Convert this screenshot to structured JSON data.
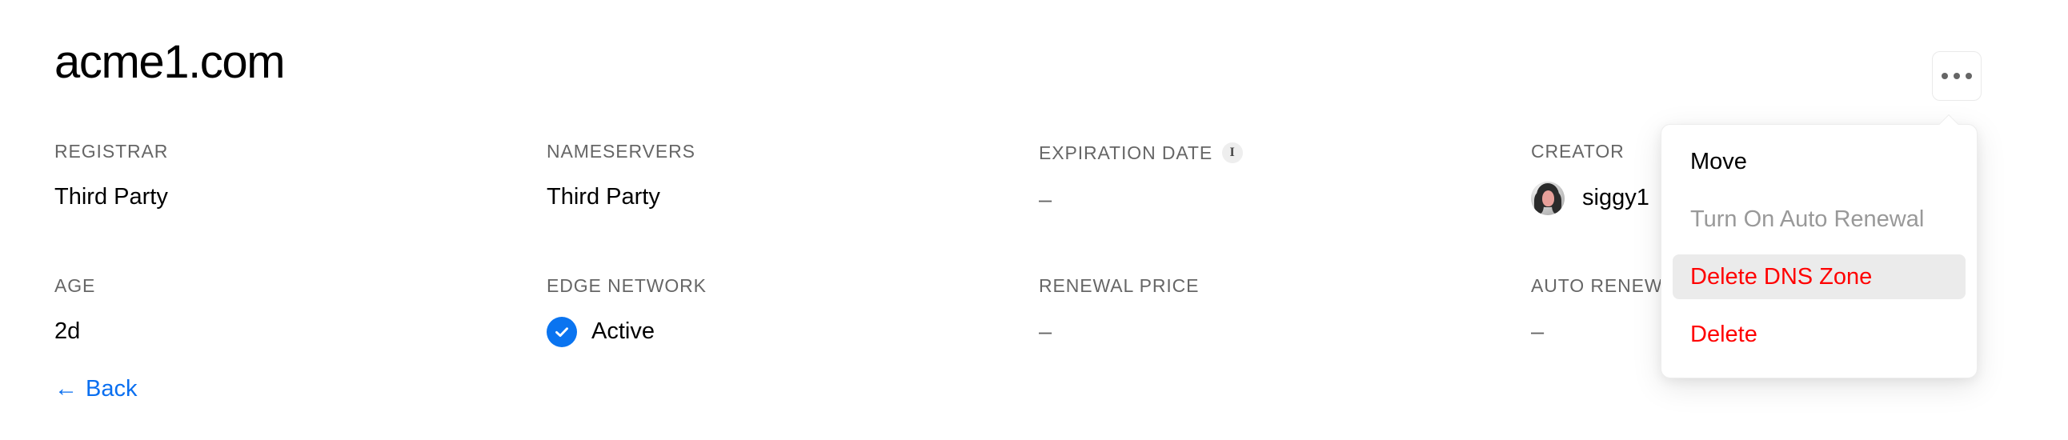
{
  "header": {
    "title": "acme1.com",
    "overflow_button_label": "…",
    "overflow_icon": "ellipsis-icon"
  },
  "fields": [
    {
      "label": "REGISTRAR",
      "value": "Third Party",
      "type": "text"
    },
    {
      "label": "NAMESERVERS",
      "value": "Third Party",
      "type": "text"
    },
    {
      "label": "EXPIRATION DATE",
      "value": "–",
      "type": "dash",
      "info_icon": "info-icon",
      "info_icon_label": "i"
    },
    {
      "label": "CREATOR",
      "value": "siggy1",
      "type": "creator",
      "avatar_icon": "user-avatar"
    },
    {
      "label": "AGE",
      "value": "2d",
      "type": "text"
    },
    {
      "label": "EDGE NETWORK",
      "value": "Active",
      "type": "status",
      "status_icon": "check-circle-icon",
      "status_color": "#0a74f0"
    },
    {
      "label": "RENEWAL PRICE",
      "value": "–",
      "type": "dash"
    },
    {
      "label": "AUTO RENEWAL",
      "value": "–",
      "type": "dash"
    }
  ],
  "menu": {
    "items": [
      {
        "label": "Move",
        "state": "normal"
      },
      {
        "label": "Turn On Auto Renewal",
        "state": "disabled"
      },
      {
        "label": "Delete DNS Zone",
        "state": "danger-highlighted"
      },
      {
        "label": "Delete",
        "state": "danger"
      }
    ]
  },
  "footer": {
    "back_arrow": "←",
    "back_label": "Back"
  },
  "colors": {
    "accent_blue": "#0a6ff0",
    "danger_red": "#ff0000",
    "label_gray": "#666666",
    "highlight_gray": "#ebebeb",
    "border_gray": "#eaeaea"
  }
}
